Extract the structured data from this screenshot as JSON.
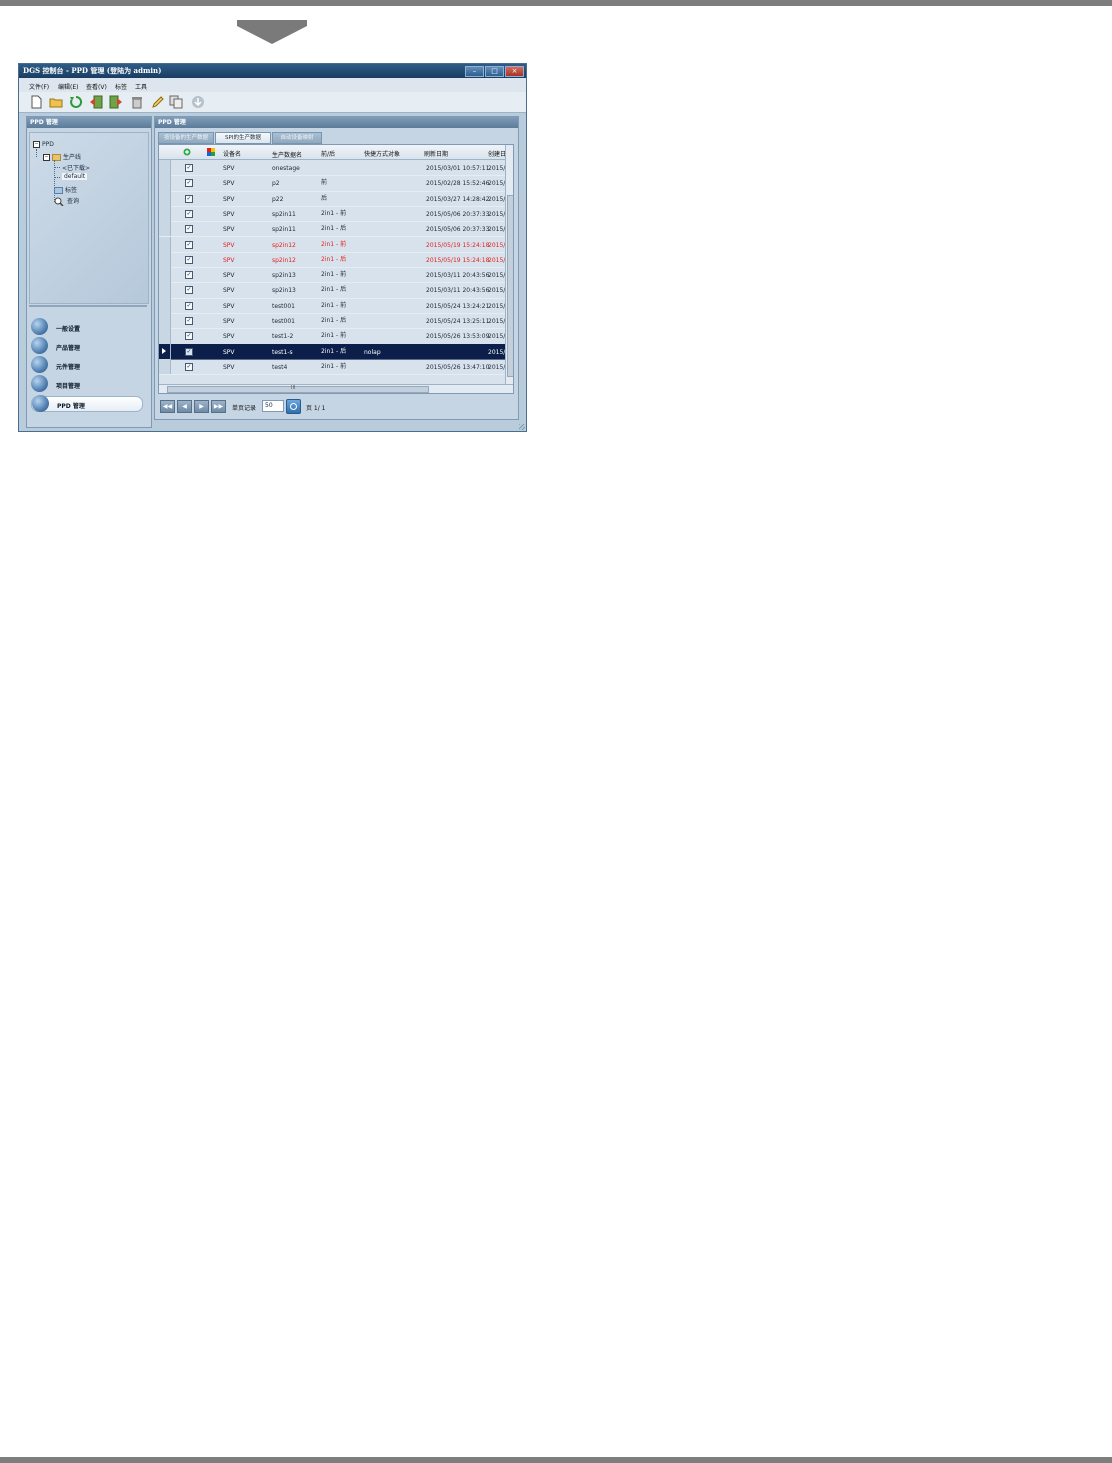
{
  "window": {
    "title": "DGS 控制台 - PPD 管理 (登陆为 admin)",
    "minimize": "–",
    "maximize": "□",
    "close": "×"
  },
  "menu": [
    "文件(F)",
    "编辑(E)",
    "查看(V)",
    "标签",
    "工具"
  ],
  "toolbar": [
    "new-icon",
    "open-folder-icon",
    "refresh-icon",
    "import-icon",
    "export-icon",
    "delete-icon",
    "edit-icon",
    "copy-icon",
    "download-icon"
  ],
  "left_panel": {
    "header": "PPD 管理",
    "tree": {
      "root": "PPD",
      "production_line": "生产线",
      "downloaded": "<已下载>",
      "default": "default",
      "tag": "标签",
      "query": "查询"
    },
    "nav": [
      "一般设置",
      "产品管理",
      "元件管理",
      "项目管理",
      "PPD 管理"
    ]
  },
  "right_panel": {
    "header": "PPD 管理",
    "tabs": [
      "按设备的生产数据",
      "SPI的生产数据",
      "自动设备映射"
    ],
    "columns": {
      "device": "设备名",
      "production_data": "生产数据名",
      "side": "前/后",
      "shortcut": "快捷方式对象",
      "refresh_date": "刷新日期",
      "create_date": "创建日"
    },
    "rows": [
      {
        "check": "✓",
        "device": "SPV",
        "name": "onestage",
        "side": "",
        "shortcut": "",
        "refresh": "2015/03/01 10:57:11",
        "created": "2015/0"
      },
      {
        "check": "✓",
        "device": "SPV",
        "name": "p2",
        "side": "前",
        "shortcut": "",
        "refresh": "2015/02/28 15:52:46",
        "created": "2015/0"
      },
      {
        "check": "✓",
        "device": "SPV",
        "name": "p22",
        "side": "后",
        "shortcut": "",
        "refresh": "2015/03/27 14:28:42",
        "created": "2015/0"
      },
      {
        "check": "✓",
        "device": "SPV",
        "name": "sp2in11",
        "side": "2in1 - 前",
        "shortcut": "",
        "refresh": "2015/05/06 20:37:33",
        "created": "2015/0"
      },
      {
        "check": "✓",
        "device": "SPV",
        "name": "sp2in11",
        "side": "2in1 - 后",
        "shortcut": "",
        "refresh": "2015/05/06 20:37:33",
        "created": "2015/0"
      },
      {
        "check": "✓",
        "device": "SPV",
        "name": "sp2in12",
        "side": "2in1 - 前",
        "shortcut": "",
        "refresh": "2015/05/19 15:24:18",
        "created": "2015/0",
        "highlight": "red"
      },
      {
        "check": "✓",
        "device": "SPV",
        "name": "sp2in12",
        "side": "2in1 - 后",
        "shortcut": "",
        "refresh": "2015/05/19 15:24:18",
        "created": "2015/0",
        "highlight": "red"
      },
      {
        "check": "✓",
        "device": "SPV",
        "name": "sp2in13",
        "side": "2in1 - 前",
        "shortcut": "",
        "refresh": "2015/03/11 20:43:56",
        "created": "2015/0"
      },
      {
        "check": "✓",
        "device": "SPV",
        "name": "sp2in13",
        "side": "2in1 - 后",
        "shortcut": "",
        "refresh": "2015/03/11 20:43:56",
        "created": "2015/0"
      },
      {
        "check": "✓",
        "device": "SPV",
        "name": "test001",
        "side": "2in1 - 前",
        "shortcut": "",
        "refresh": "2015/05/24 13:24:21",
        "created": "2015/0"
      },
      {
        "check": "✓",
        "device": "SPV",
        "name": "test001",
        "side": "2in1 - 后",
        "shortcut": "",
        "refresh": "2015/05/24 13:25:11",
        "created": "2015/0"
      },
      {
        "check": "✓",
        "device": "SPV",
        "name": "test1-2",
        "side": "2in1 - 前",
        "shortcut": "",
        "refresh": "2015/05/26 13:53:09",
        "created": "2015/0"
      },
      {
        "check": "✓",
        "device": "SPV",
        "name": "test1-s",
        "side": "2in1 - 后",
        "shortcut": "nolap",
        "refresh": "",
        "created": "2015/0",
        "selected": true
      },
      {
        "check": "✓",
        "device": "SPV",
        "name": "test4",
        "side": "2in1 - 前",
        "shortcut": "",
        "refresh": "2015/05/26 13:47:10",
        "created": "2015/0"
      }
    ],
    "scroll_mark": "III",
    "pager": {
      "first": "◀◀",
      "prev": "◀",
      "next": "▶",
      "last": "▶▶",
      "per_page_label": "单页记录",
      "per_page_value": "50",
      "page_info": "页 1/ 1"
    }
  },
  "colors": {
    "title_bar": "#1f4a73",
    "selected_row": "#0b1f4a",
    "highlight_red": "#e0231f",
    "panel_bg": "#c6d5e3"
  }
}
